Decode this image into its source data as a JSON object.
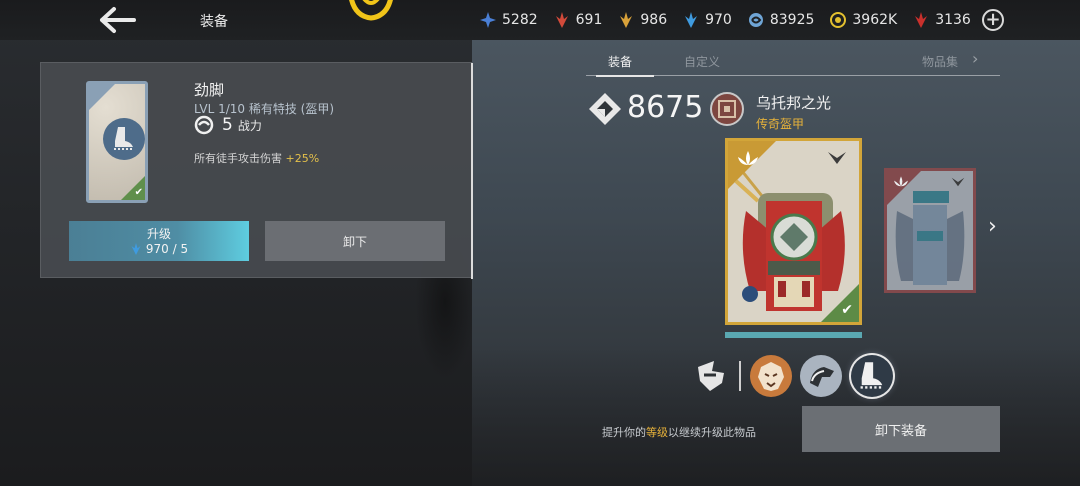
{
  "header": {
    "title": "装备",
    "currencies": [
      {
        "name": "blue-star-icon",
        "value": "5282",
        "color": "#4a7fd6"
      },
      {
        "name": "red-crystal-icon",
        "value": "691",
        "color": "#d24a3a"
      },
      {
        "name": "gold-crystal-icon",
        "value": "986",
        "color": "#d9a23a"
      },
      {
        "name": "blue-crystal-icon",
        "value": "970",
        "color": "#3f9be0"
      },
      {
        "name": "swirl-icon",
        "value": "83925",
        "color": "#6fa5d6"
      },
      {
        "name": "coin-icon",
        "value": "3962K",
        "color": "#e3c02f"
      },
      {
        "name": "ruby-icon",
        "value": "3136",
        "color": "#c9302c"
      }
    ]
  },
  "item": {
    "name": "劲脚",
    "level": "LVL  1/10  稀有特技 (盔甲)",
    "power_value": "5",
    "power_label": "战力",
    "desc_prefix": "所有徒手攻击伤害 ",
    "desc_bonus": "+25%",
    "upgrade_label": "升级",
    "upgrade_cost": "970 / 5",
    "unequip_label": "卸下"
  },
  "tabs": {
    "equipment": "装备",
    "custom": "自定义",
    "collection": "物品集"
  },
  "armor": {
    "power": "8675",
    "set_name": "乌托邦之光",
    "set_rarity": "传奇盔甲"
  },
  "footer": {
    "hint_prefix": "提升你的",
    "hint_highlight": "等级",
    "hint_suffix": "以继续升级此物品",
    "equip_label": "卸下装备"
  },
  "colors": {
    "accent_gold": "#e7b23a",
    "upgrade_cyan": "#5ecde0",
    "legendary_border": "#d2a539",
    "rare_border": "#8aa0b5"
  }
}
